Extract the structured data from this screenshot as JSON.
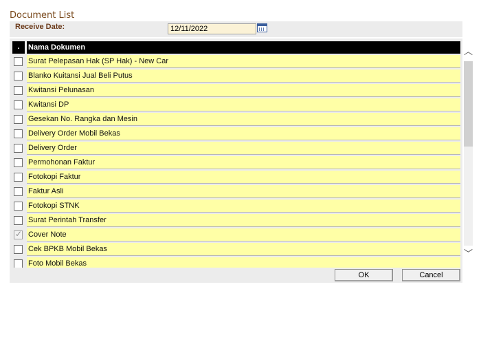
{
  "window": {
    "title": "Document List"
  },
  "filter": {
    "receive_date_label": "Receive Date:",
    "receive_date_value": "12/11/2022"
  },
  "table": {
    "headers": {
      "check": ".",
      "name": "Nama Dokumen"
    },
    "rows": [
      {
        "name": "Surat Pelepasan Hak (SP Hak) - New Car",
        "checked": false
      },
      {
        "name": "Blanko Kuitansi Jual Beli Putus",
        "checked": false
      },
      {
        "name": "Kwitansi Pelunasan",
        "checked": false
      },
      {
        "name": "Kwitansi DP",
        "checked": false
      },
      {
        "name": "Gesekan No. Rangka dan Mesin",
        "checked": false
      },
      {
        "name": "Delivery Order Mobil Bekas",
        "checked": false
      },
      {
        "name": "Delivery Order",
        "checked": false
      },
      {
        "name": "Permohonan Faktur",
        "checked": false
      },
      {
        "name": "Fotokopi Faktur",
        "checked": false
      },
      {
        "name": "Faktur Asli",
        "checked": false
      },
      {
        "name": "Fotokopi STNK",
        "checked": false
      },
      {
        "name": "Surat Perintah Transfer",
        "checked": false
      },
      {
        "name": "Cover Note",
        "checked": true
      },
      {
        "name": "Cek BPKB Mobil Bekas",
        "checked": false
      },
      {
        "name": "Foto Mobil Bekas",
        "checked": false
      }
    ]
  },
  "buttons": {
    "ok": "OK",
    "cancel": "Cancel"
  },
  "icons": {
    "calendar": "calendar-icon",
    "scroll_up": "chevron-up-icon",
    "scroll_down": "chevron-down-icon"
  }
}
